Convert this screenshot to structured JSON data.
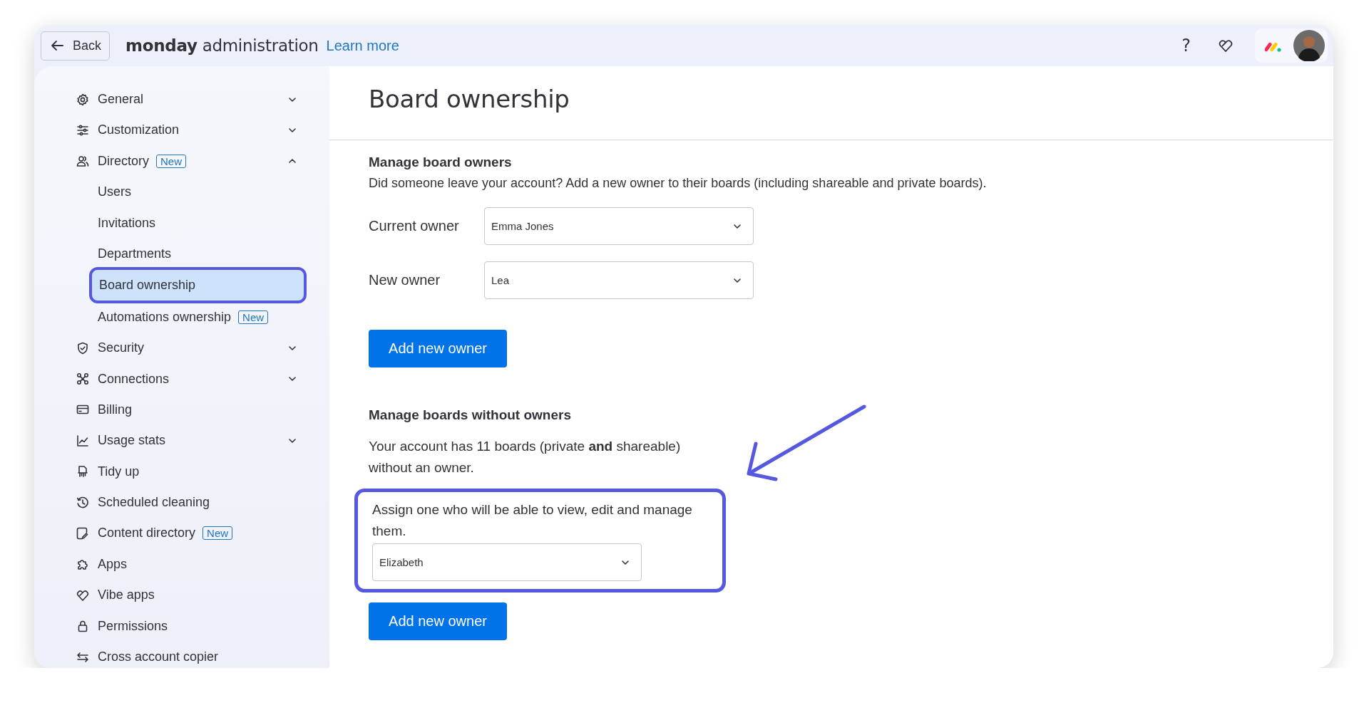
{
  "topbar": {
    "back": "Back",
    "brand": "monday",
    "title": "administration",
    "link": "Learn more",
    "help": "?"
  },
  "sidebar": {
    "items": [
      {
        "label": "General",
        "expanded": false,
        "selected": false
      },
      {
        "label": "Customization",
        "expanded": false,
        "selected": false
      },
      {
        "label": "Directory",
        "badge": "New",
        "expanded": true,
        "selected": false,
        "children": [
          {
            "label": "Users",
            "selected": false
          },
          {
            "label": "Invitations",
            "selected": false
          },
          {
            "label": "Departments",
            "selected": false
          },
          {
            "label": "Board ownership",
            "selected": true
          },
          {
            "label": "Automations ownership",
            "badge": "New",
            "selected": false
          }
        ]
      },
      {
        "label": "Security",
        "expanded": false,
        "selected": false
      },
      {
        "label": "Connections",
        "expanded": false,
        "selected": false
      },
      {
        "label": "Billing",
        "selected": false
      },
      {
        "label": "Usage stats",
        "expanded": false,
        "selected": false
      },
      {
        "label": "Tidy up",
        "selected": false
      },
      {
        "label": "Scheduled cleaning",
        "selected": false
      },
      {
        "label": "Content directory",
        "badge": "New",
        "selected": false
      },
      {
        "label": "Apps",
        "selected": false
      },
      {
        "label": "Vibe apps",
        "selected": false
      },
      {
        "label": "Permissions",
        "selected": false
      },
      {
        "label": "Cross account copier",
        "selected": false
      }
    ]
  },
  "page_title": "Board ownership",
  "sections": [
    {
      "heading": "Manage board owners",
      "description": "Did someone leave your account? Add a new owner to their boards (including shareable and private boards).",
      "fields": [
        {
          "label": "Current owner",
          "value": "Emma Jones"
        },
        {
          "label": "New owner",
          "value": "Lea"
        }
      ],
      "button": "Add new owner"
    },
    {
      "heading": "Manage boards without owners",
      "description": "Your account has 11 boards (private **and** shareable) without an owner.",
      "assign": {
        "text": "Assign one who will be able to view, edit and manage them.",
        "value": "Elizabeth",
        "highlighted": true
      },
      "annotation_arrow": true,
      "button": "Add new owner"
    }
  ]
}
